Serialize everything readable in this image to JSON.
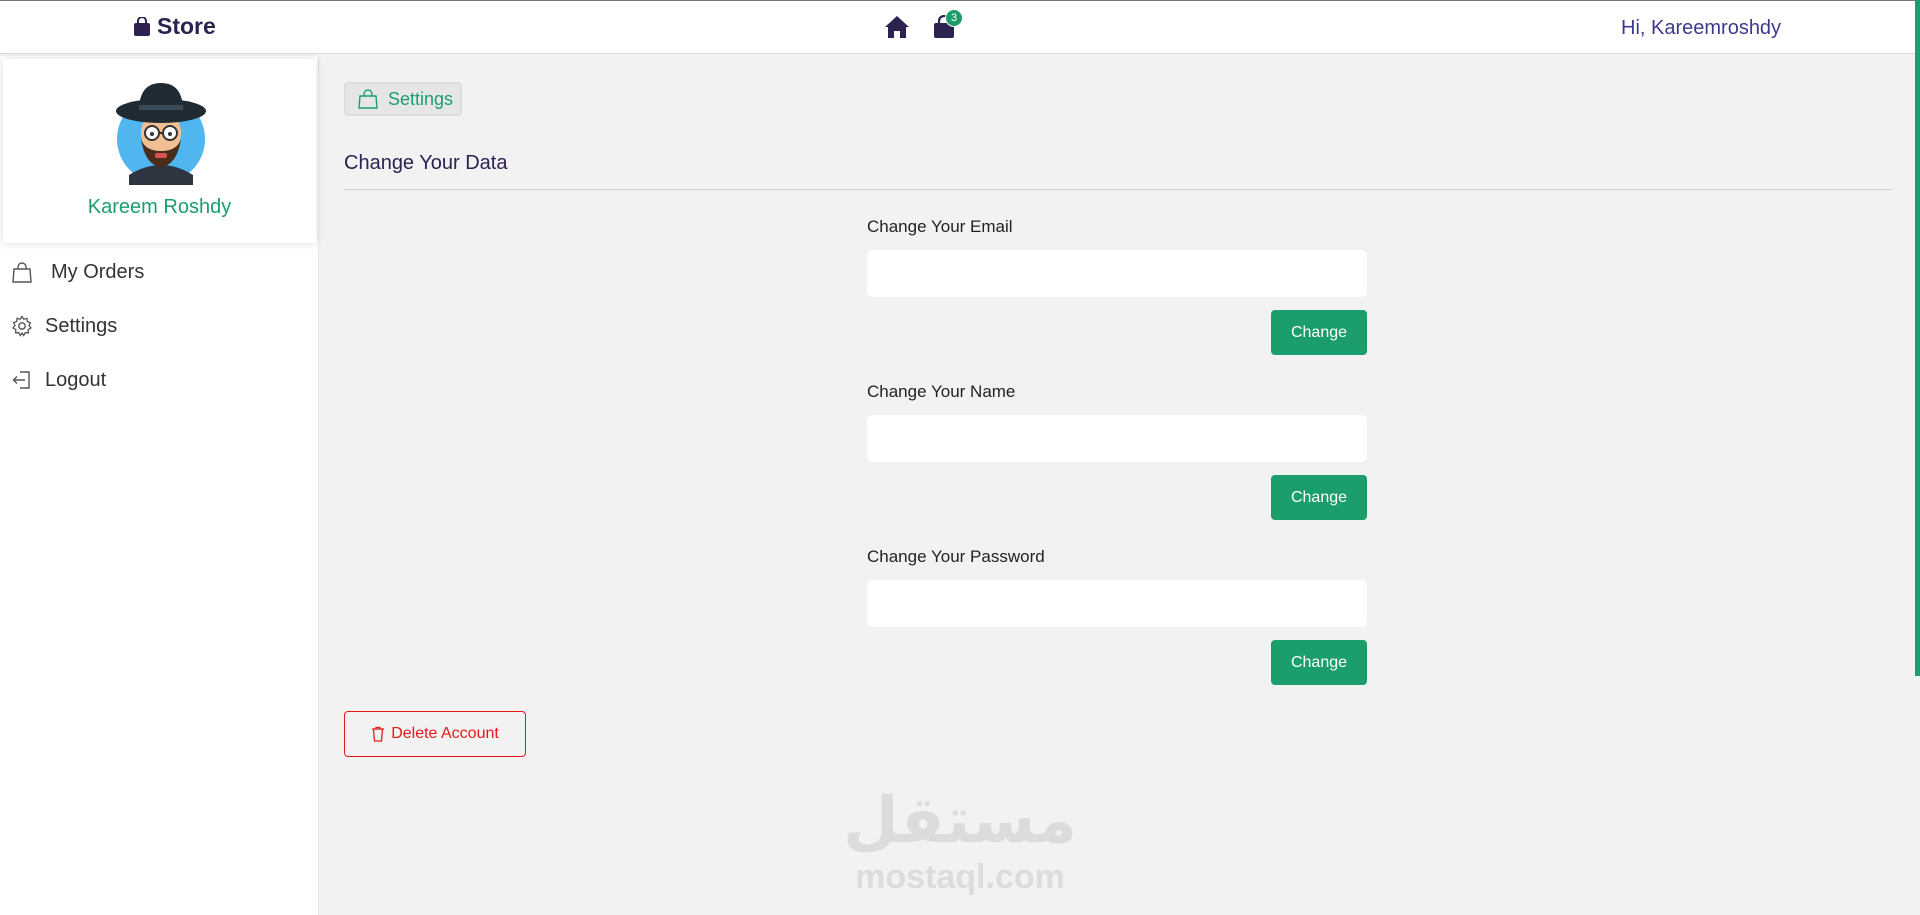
{
  "header": {
    "brand": "Store",
    "cart_count": "3",
    "greeting": "Hi, Kareemroshdy"
  },
  "sidebar": {
    "profile_name": "Kareem Roshdy",
    "items": [
      {
        "label": "My Orders",
        "icon": "shopping-bag-icon"
      },
      {
        "label": "Settings",
        "icon": "gear-icon"
      },
      {
        "label": "Logout",
        "icon": "logout-icon"
      }
    ]
  },
  "main": {
    "breadcrumb": "Settings",
    "section_title": "Change Your Data",
    "fields": [
      {
        "label": "Change Your Email",
        "value": "",
        "button": "Change"
      },
      {
        "label": "Change Your Name",
        "value": "",
        "button": "Change"
      },
      {
        "label": "Change Your Password",
        "value": "",
        "button": "Change"
      }
    ],
    "delete_label": "Delete Account"
  },
  "watermark": {
    "arabic": "مستقل",
    "text": "mostaql.com"
  },
  "colors": {
    "accent_green": "#1b9e6c",
    "brand_purple": "#2d2150",
    "greeting_blue": "#3d3a8c",
    "danger_red": "#e21a1a"
  }
}
